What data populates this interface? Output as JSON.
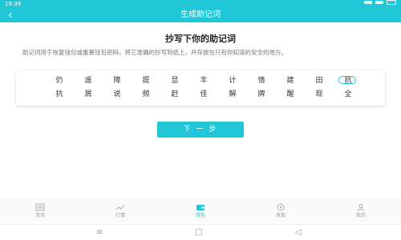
{
  "status_bar": {
    "time": "16:39"
  },
  "nav": {
    "back_icon": "‹",
    "title": "生成助记词"
  },
  "heading": "抄写下你的助记词",
  "description": "助记词用于恢复钱包或重置钱包密码，将它准确的抄写到纸上，并存放在只有你知道的安全的地方。",
  "words": [
    "仍",
    "遥",
    "障",
    "提",
    "显",
    "丰",
    "计",
    "情",
    "建",
    "田",
    "抗",
    "抗",
    "屑",
    "说",
    "频",
    "赶",
    "佳",
    "解",
    "牌",
    "醒",
    "现",
    "全"
  ],
  "next_button": "下 一 步",
  "tabs": [
    {
      "label": "资讯",
      "icon": "news-icon",
      "active": false
    },
    {
      "label": "行情",
      "icon": "market-icon",
      "active": false
    },
    {
      "label": "钱包",
      "icon": "wallet-icon",
      "active": true
    },
    {
      "label": "发现",
      "icon": "discover-icon",
      "active": false
    },
    {
      "label": "我的",
      "icon": "profile-icon",
      "active": false
    }
  ],
  "colors": {
    "accent": "#21c7d6",
    "text": "#333333",
    "muted": "#777777"
  },
  "system_nav": {
    "menu_icon": "≡",
    "home_icon": "□",
    "back_icon": "◁"
  }
}
